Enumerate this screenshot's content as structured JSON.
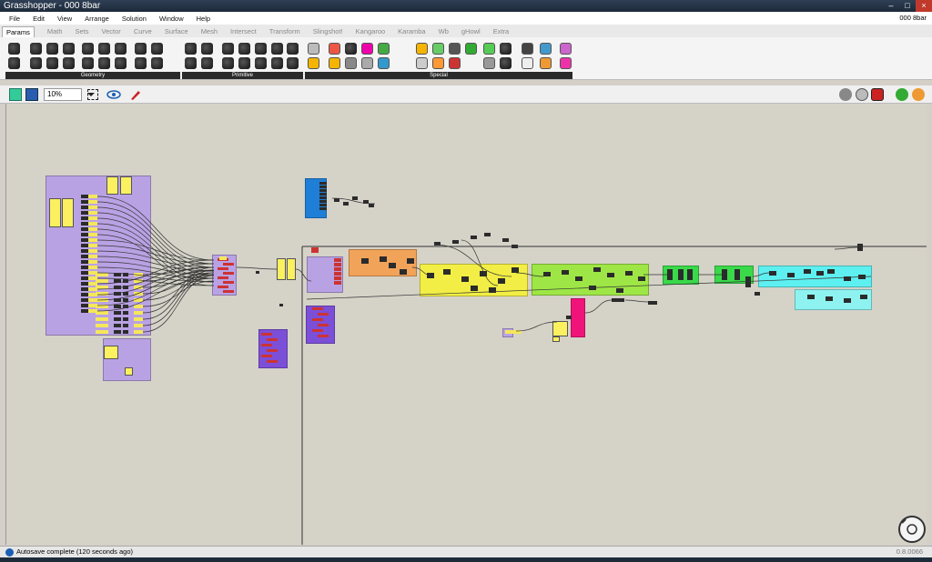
{
  "window": {
    "title": "Grasshopper - 000 8bar"
  },
  "menu": {
    "items": [
      "File",
      "Edit",
      "View",
      "Arrange",
      "Solution",
      "Window",
      "Help"
    ],
    "document_name": "000 8bar"
  },
  "tabs": [
    "Params",
    "Math",
    "Sets",
    "Vector",
    "Curve",
    "Surface",
    "Mesh",
    "Intersect",
    "Transform",
    "Slingshot!",
    "Kangaroo",
    "Karamba",
    "Wb",
    "gHowl",
    "Extra"
  ],
  "active_tab": "Params",
  "ribbon": {
    "panels": [
      "Geometry",
      "Primitive",
      "Special"
    ]
  },
  "canvas_toolbar": {
    "zoom": "10%"
  },
  "status": {
    "message": "Autosave complete (120 seconds ago)",
    "version": "0.8.0066"
  },
  "colors": {
    "group_purple": "#b9a2e4",
    "group_orange": "#f2a35a",
    "group_yellow": "#f2ee45",
    "group_green": "#9ee645",
    "group_bright_green": "#39d94a",
    "group_cyan": "#5ef0f0",
    "group_blue": "#1f7fd6",
    "group_magenta": "#f0147a",
    "panel_yellow": "#fbf060"
  }
}
